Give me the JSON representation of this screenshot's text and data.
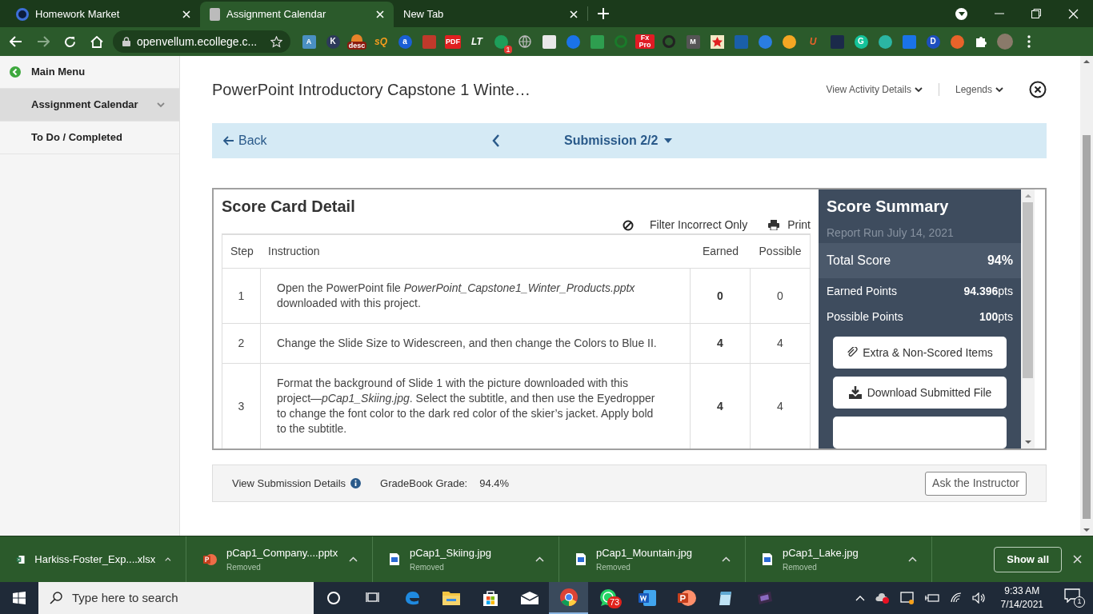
{
  "browser": {
    "tabs": [
      {
        "title": "Homework Market",
        "selected": false
      },
      {
        "title": "Assignment Calendar",
        "selected": true
      },
      {
        "title": "New Tab",
        "selected": false
      }
    ],
    "url": "openvellum.ecollege.c...",
    "extensions": [
      {
        "kind": "square",
        "glyph": "A",
        "color": "#4a90c2"
      },
      {
        "kind": "circle",
        "glyph": "K",
        "color": "#2d3a5a"
      },
      {
        "kind": "bell",
        "badge": "desc",
        "color": "#e8832a"
      },
      {
        "kind": "text",
        "glyph": "sQ",
        "color": "#f29b1d"
      },
      {
        "kind": "circle",
        "glyph": "a",
        "color": "#1a5fd6"
      },
      {
        "kind": "square",
        "color": "#c0392b"
      },
      {
        "kind": "square",
        "glyph": "PDF",
        "color": "#e02020"
      },
      {
        "kind": "text",
        "glyph": "LT",
        "color": "#ffffff"
      },
      {
        "kind": "circle",
        "badge": "1",
        "color": "#1e9e5a"
      },
      {
        "kind": "globe",
        "color": "#bbbbbb"
      },
      {
        "kind": "square",
        "color": "#e8e8e8"
      },
      {
        "kind": "circle",
        "color": "#1a73e8"
      },
      {
        "kind": "square",
        "color": "#2e9e4f"
      },
      {
        "kind": "ring",
        "color": "#1a7a2a"
      },
      {
        "kind": "square",
        "glyph": "Fx Pro",
        "color": "#e01b24"
      },
      {
        "kind": "ring",
        "color": "#222222"
      },
      {
        "kind": "square",
        "glyph": "M",
        "color": "#555555"
      },
      {
        "kind": "star",
        "color": "#e02020"
      },
      {
        "kind": "square",
        "color": "#1a5fa8"
      },
      {
        "kind": "circle",
        "color": "#2a7de1"
      },
      {
        "kind": "circle",
        "color": "#f5a623"
      },
      {
        "kind": "text",
        "glyph": "U",
        "color": "#e8622a"
      },
      {
        "kind": "square",
        "color": "#1b2a4a"
      },
      {
        "kind": "circle",
        "glyph": "G",
        "color": "#15c39a"
      },
      {
        "kind": "circle",
        "color": "#2bb5a3"
      },
      {
        "kind": "square",
        "color": "#1a73e8"
      },
      {
        "kind": "circle",
        "glyph": "D",
        "color": "#1d4fbf"
      },
      {
        "kind": "circle",
        "color": "#e8632a"
      }
    ]
  },
  "sidebar": {
    "items": [
      {
        "label": "Main Menu",
        "kind": "back",
        "selected": false
      },
      {
        "label": "Assignment Calendar",
        "kind": "expandable",
        "selected": true
      },
      {
        "label": "To Do / Completed",
        "kind": "link",
        "selected": false
      }
    ]
  },
  "header": {
    "title": "PowerPoint Introductory Capstone 1 Winte…",
    "menus": [
      "View Activity Details",
      "Legends"
    ]
  },
  "nav": {
    "back": "Back",
    "submission": "Submission 2/2"
  },
  "score_card": {
    "title": "Score Card Detail",
    "filter": "Filter Incorrect Only",
    "print": "Print",
    "columns": [
      "Step",
      "Instruction",
      "Earned",
      "Possible"
    ],
    "rows": [
      {
        "step": "1",
        "instruction": "Open the PowerPoint file *PowerPoint_Capstone1_Winter_Products.pptx* downloaded with this project.",
        "earned": "0",
        "possible": "0"
      },
      {
        "step": "2",
        "instruction": "Change the Slide Size to Widescreen, and then change the Colors to Blue II.",
        "earned": "4",
        "possible": "4"
      },
      {
        "step": "3",
        "instruction": "Format the background of Slide 1 with the picture downloaded with this project—*pCap1_Skiing.jpg*. Select the subtitle, and then use the Eyedropper to change the font color to the dark red color of the skier’s jacket. Apply bold to the subtitle.",
        "earned": "4",
        "possible": "4"
      }
    ]
  },
  "summary": {
    "title": "Score Summary",
    "report_run": "Report Run July 14, 2021",
    "total_label": "Total Score",
    "total": "94%",
    "stats": [
      {
        "label": "Earned Points",
        "value": "94.396",
        "unit": "pts"
      },
      {
        "label": "Possible Points",
        "value": "100",
        "unit": "pts"
      }
    ],
    "buttons": [
      {
        "label": "Extra & Non-Scored Items",
        "kind": "paperclip"
      },
      {
        "label": "Download Submitted File",
        "kind": "download"
      }
    ]
  },
  "footer": {
    "details_link": "View Submission Details",
    "grade_label": "GradeBook Grade:",
    "grade": "94.4%",
    "ask": "Ask the Instructor"
  },
  "downloads": {
    "items": [
      {
        "name": "Harkiss-Foster_Exp....xlsx",
        "kind": "excel"
      },
      {
        "name": "pCap1_Company....pptx",
        "status": "Removed",
        "kind": "powerpoint"
      },
      {
        "name": "pCap1_Skiing.jpg",
        "status": "Removed",
        "kind": "image"
      },
      {
        "name": "pCap1_Mountain.jpg",
        "status": "Removed",
        "kind": "image"
      },
      {
        "name": "pCap1_Lake.jpg",
        "status": "Removed",
        "kind": "image"
      }
    ],
    "show_all": "Show all"
  },
  "taskbar": {
    "search_placeholder": "Type here to search",
    "apps": [
      {
        "kind": "cortana",
        "selected": false
      },
      {
        "kind": "taskview",
        "selected": false
      },
      {
        "kind": "edge",
        "selected": false
      },
      {
        "kind": "explorer",
        "selected": false
      },
      {
        "kind": "store",
        "selected": false
      },
      {
        "kind": "mail",
        "selected": false
      },
      {
        "kind": "chrome",
        "selected": true
      },
      {
        "kind": "whatsapp",
        "selected": false,
        "badge": "73"
      },
      {
        "kind": "word",
        "selected": false
      },
      {
        "kind": "powerpoint",
        "selected": false
      },
      {
        "kind": "notepad",
        "selected": false
      },
      {
        "kind": "video",
        "selected": false
      }
    ],
    "time": "9:33 AM",
    "date": "7/14/2021",
    "notifications": "1"
  }
}
